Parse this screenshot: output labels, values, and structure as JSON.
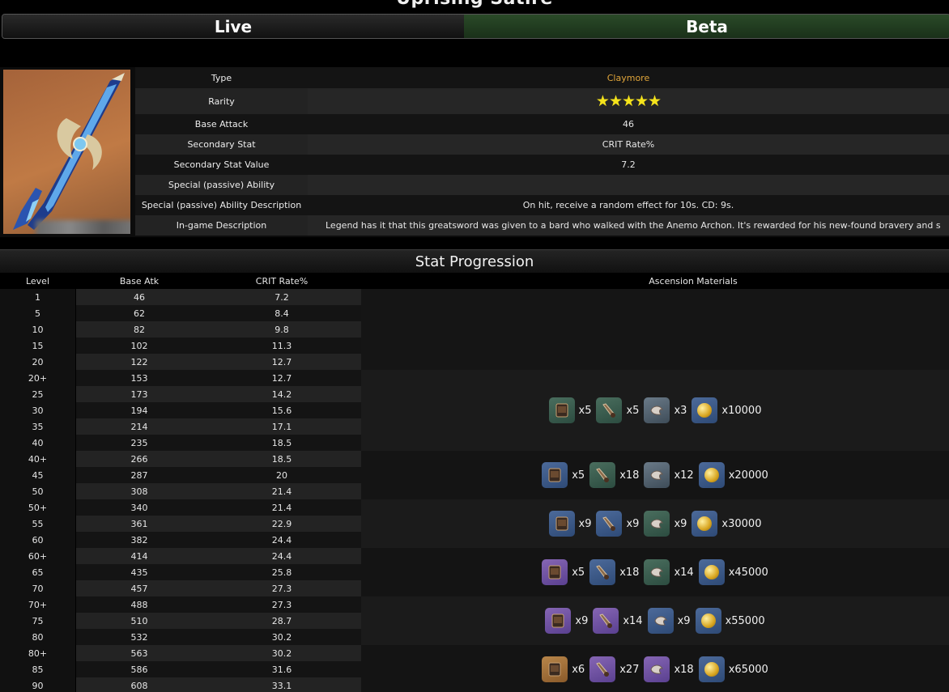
{
  "page": {
    "title": "Uprising Satire"
  },
  "tabs": [
    {
      "label": "Live"
    },
    {
      "label": "Beta"
    }
  ],
  "info": {
    "type_label": "Type",
    "type_value": "Claymore",
    "rarity_label": "Rarity",
    "rarity_value": "★★★★★",
    "base_attack_label": "Base Attack",
    "base_attack_value": "46",
    "secondary_stat_label": "Secondary Stat",
    "secondary_stat_value": "CRIT Rate%",
    "secondary_stat_value_label": "Secondary Stat Value",
    "secondary_stat_value_value": "7.2",
    "passive_label": "Special (passive) Ability",
    "passive_value": "",
    "passive_desc_label": "Special (passive) Ability Description",
    "passive_desc_value": "On hit, receive a random effect for 10s. CD: 9s.",
    "ingame_desc_label": "In-game Description",
    "ingame_desc_value": "Legend has it that this greatsword was given to a bard who walked with the Anemo Archon. It's rewarded for his new-found bravery and s"
  },
  "progression": {
    "header": "Stat Progression",
    "columns": {
      "level": "Level",
      "base_atk": "Base Atk",
      "crit": "CRIT Rate%",
      "materials": "Ascension Materials"
    },
    "rows": [
      [
        "1",
        "46",
        "7.2"
      ],
      [
        "5",
        "62",
        "8.4"
      ],
      [
        "10",
        "82",
        "9.8"
      ],
      [
        "15",
        "102",
        "11.3"
      ],
      [
        "20",
        "122",
        "12.7"
      ],
      [
        "20+",
        "153",
        "12.7"
      ],
      [
        "25",
        "173",
        "14.2"
      ],
      [
        "30",
        "194",
        "15.6"
      ],
      [
        "35",
        "214",
        "17.1"
      ],
      [
        "40",
        "235",
        "18.5"
      ],
      [
        "40+",
        "266",
        "18.5"
      ],
      [
        "45",
        "287",
        "20"
      ],
      [
        "50",
        "308",
        "21.4"
      ],
      [
        "50+",
        "340",
        "21.4"
      ],
      [
        "55",
        "361",
        "22.9"
      ],
      [
        "60",
        "382",
        "24.4"
      ],
      [
        "60+",
        "414",
        "24.4"
      ],
      [
        "65",
        "435",
        "25.8"
      ],
      [
        "70",
        "457",
        "27.3"
      ],
      [
        "70+",
        "488",
        "27.3"
      ],
      [
        "75",
        "510",
        "28.7"
      ],
      [
        "80",
        "532",
        "30.2"
      ],
      [
        "80+",
        "563",
        "30.2"
      ],
      [
        "85",
        "586",
        "31.6"
      ],
      [
        "90",
        "608",
        "33.1"
      ]
    ],
    "ascensions": [
      {
        "items": [
          {
            "icon": "scroll-icon",
            "tone": "g",
            "count": "x5"
          },
          {
            "icon": "horn-icon",
            "tone": "g",
            "count": "x5"
          },
          {
            "icon": "claw-icon",
            "tone": "gray",
            "count": "x3"
          },
          {
            "icon": "mora-coin-icon",
            "tone": "b",
            "count": "x10000"
          }
        ]
      },
      {
        "items": [
          {
            "icon": "scroll-icon",
            "tone": "b",
            "count": "x5"
          },
          {
            "icon": "horn-icon",
            "tone": "g",
            "count": "x18"
          },
          {
            "icon": "claw-icon",
            "tone": "gray",
            "count": "x12"
          },
          {
            "icon": "mora-coin-icon",
            "tone": "b",
            "count": "x20000"
          }
        ]
      },
      {
        "items": [
          {
            "icon": "scroll-icon",
            "tone": "b",
            "count": "x9"
          },
          {
            "icon": "horn-icon",
            "tone": "b",
            "count": "x9"
          },
          {
            "icon": "claw-icon",
            "tone": "g",
            "count": "x9"
          },
          {
            "icon": "mora-coin-icon",
            "tone": "b",
            "count": "x30000"
          }
        ]
      },
      {
        "items": [
          {
            "icon": "scroll-icon",
            "tone": "p",
            "count": "x5"
          },
          {
            "icon": "horn-icon",
            "tone": "b",
            "count": "x18"
          },
          {
            "icon": "claw-icon",
            "tone": "g",
            "count": "x14"
          },
          {
            "icon": "mora-coin-icon",
            "tone": "b",
            "count": "x45000"
          }
        ]
      },
      {
        "items": [
          {
            "icon": "scroll-icon",
            "tone": "p",
            "count": "x9"
          },
          {
            "icon": "horn-icon",
            "tone": "p",
            "count": "x14"
          },
          {
            "icon": "claw-icon",
            "tone": "b",
            "count": "x9"
          },
          {
            "icon": "mora-coin-icon",
            "tone": "b",
            "count": "x55000"
          }
        ]
      },
      {
        "items": [
          {
            "icon": "scroll-icon",
            "tone": "o",
            "count": "x6"
          },
          {
            "icon": "horn-icon",
            "tone": "p",
            "count": "x27"
          },
          {
            "icon": "claw-icon",
            "tone": "p",
            "count": "x18"
          },
          {
            "icon": "mora-coin-icon",
            "tone": "b",
            "count": "x65000"
          }
        ]
      }
    ]
  }
}
